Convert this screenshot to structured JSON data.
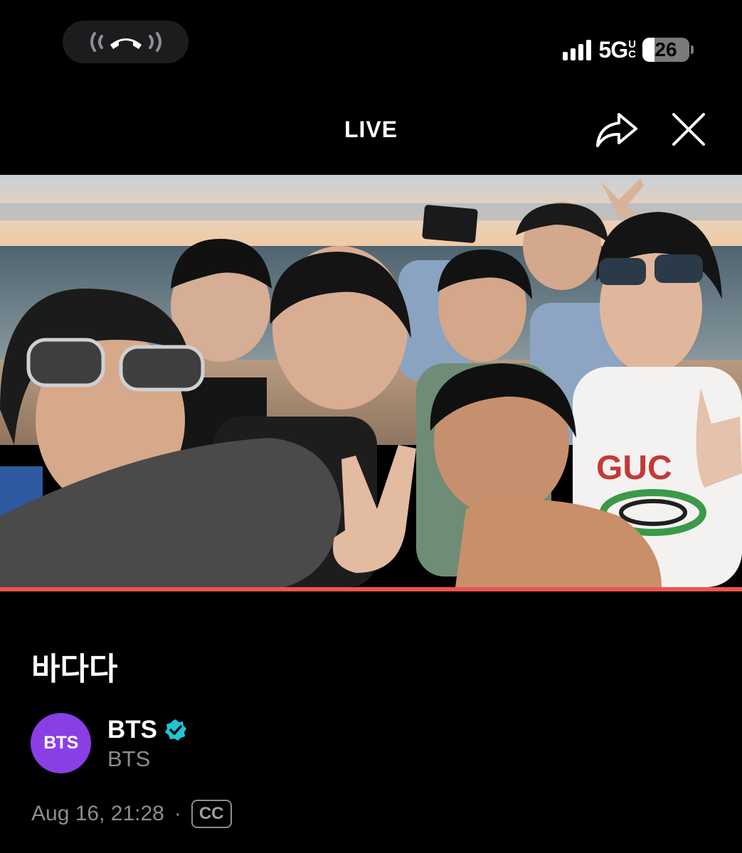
{
  "status_bar": {
    "network": "5G",
    "network_suffix": [
      "U",
      "C"
    ],
    "battery_level": "26",
    "battery_fraction": 0.26,
    "icons": [
      "call-active-icon",
      "signal-icon",
      "battery-icon"
    ]
  },
  "header": {
    "title": "LIVE",
    "icons": [
      "share-icon",
      "close-icon"
    ]
  },
  "player": {
    "progress_fraction": 1.0,
    "accent_color": "#f0534f"
  },
  "video": {
    "title": "바다다"
  },
  "channel": {
    "avatar_text": "BTS",
    "avatar_color": "#8a3ee6",
    "name": "BTS",
    "verified_icon": "verified-badge-icon",
    "verified_color": "#1fc6d6",
    "subtitle": "BTS"
  },
  "meta": {
    "date": "Aug 16, 21:28",
    "separator": "·",
    "cc_label": "CC"
  }
}
